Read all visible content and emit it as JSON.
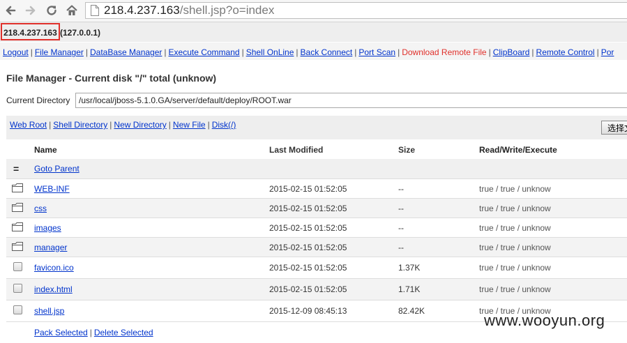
{
  "browser": {
    "url_host": "218.4.237.163",
    "url_path": "/shell.jsp?o=index"
  },
  "info": {
    "server_ip": "218.4.237.163",
    "local_ip": "(127.0.0.1)"
  },
  "menu": [
    {
      "label": "Logout"
    },
    {
      "label": "File Manager"
    },
    {
      "label": "DataBase Manager"
    },
    {
      "label": "Execute Command"
    },
    {
      "label": "Shell OnLine"
    },
    {
      "label": "Back Connect"
    },
    {
      "label": "Port Scan"
    },
    {
      "label": "Download Remote File",
      "highlight": true
    },
    {
      "label": "ClipBoard"
    },
    {
      "label": "Remote Control"
    },
    {
      "label": "Por"
    }
  ],
  "file_manager": {
    "title": "File Manager - Current disk \"/\" total (unknow)",
    "current_dir_label": "Current Directory",
    "current_dir_value": "/usr/local/jboss-5.1.0.GA/server/default/deploy/ROOT.war",
    "tool_links": [
      "Web Root",
      "Shell Directory",
      "New Directory",
      "New File",
      "Disk(/)"
    ],
    "choose_button": "选择文",
    "columns": {
      "name": "Name",
      "modified": "Last Modified",
      "size": "Size",
      "rwx": "Read/Write/Execute"
    },
    "parent_icon": "=",
    "parent_label": "Goto Parent",
    "directories": [
      {
        "name": "WEB-INF",
        "modified": "2015-02-15 01:52:05",
        "size": "--",
        "rwx": "true / true / unknow"
      },
      {
        "name": "css",
        "modified": "2015-02-15 01:52:05",
        "size": "--",
        "rwx": "true / true / unknow"
      },
      {
        "name": "images",
        "modified": "2015-02-15 01:52:05",
        "size": "--",
        "rwx": "true / true / unknow"
      },
      {
        "name": "manager",
        "modified": "2015-02-15 01:52:05",
        "size": "--",
        "rwx": "true / true / unknow"
      }
    ],
    "files": [
      {
        "name": "favicon.ico",
        "modified": "2015-02-15 01:52:05",
        "size": "1.37K",
        "rwx": "true / true / unknow"
      },
      {
        "name": "index.html",
        "modified": "2015-02-15 01:52:05",
        "size": "1.71K",
        "rwx": "true / true / unknow"
      },
      {
        "name": "shell.jsp",
        "modified": "2015-12-09 08:45:13",
        "size": "82.42K",
        "rwx": "true / true / unknow"
      }
    ],
    "bottom_links": [
      "Pack Selected",
      "Delete Selected"
    ]
  },
  "watermark": "www.wooyun.org",
  "colors": {
    "link": "#0033cc",
    "highlight_link": "#e0302b",
    "ip_box_border": "#e0302b"
  }
}
